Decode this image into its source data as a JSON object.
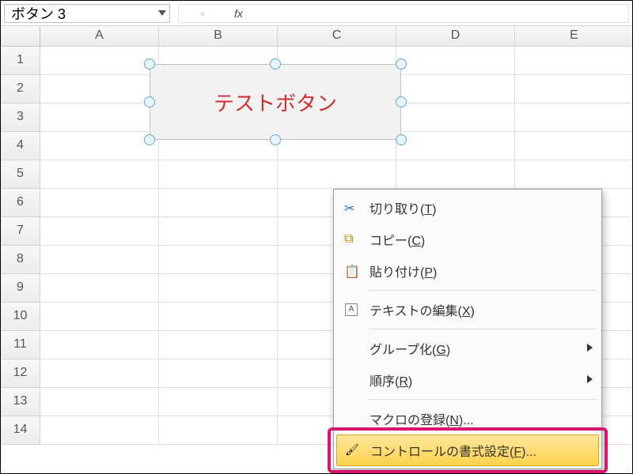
{
  "name_box": {
    "value": "ボタン 3"
  },
  "formula_bar": {
    "fx": "fx",
    "value": ""
  },
  "columns": [
    "A",
    "B",
    "C",
    "D",
    "E"
  ],
  "rows": [
    1,
    2,
    3,
    4,
    5,
    6,
    7,
    8,
    9,
    10,
    11,
    12,
    13,
    14
  ],
  "button_control": {
    "label": "テストボタン"
  },
  "context_menu": {
    "items": [
      {
        "icon": "cut",
        "label": "切り取り(",
        "mnemonic": "T",
        "suffix": ")"
      },
      {
        "icon": "copy",
        "label": "コピー(",
        "mnemonic": "C",
        "suffix": ")"
      },
      {
        "icon": "paste",
        "label": "貼り付け(",
        "mnemonic": "P",
        "suffix": ")"
      },
      {
        "sep": true
      },
      {
        "icon": "text",
        "label": "テキストの編集(",
        "mnemonic": "X",
        "suffix": ")"
      },
      {
        "sep": true
      },
      {
        "label": "グループ化(",
        "mnemonic": "G",
        "suffix": ")",
        "submenu": true
      },
      {
        "label": "順序(",
        "mnemonic": "R",
        "suffix": ")",
        "submenu": true
      },
      {
        "sep": true
      },
      {
        "label": "マクロの登録(",
        "mnemonic": "N",
        "suffix": ")..."
      },
      {
        "icon": "format",
        "label": "コントロールの書式設定(",
        "mnemonic": "F",
        "suffix": ")...",
        "highlighted": true
      }
    ]
  }
}
